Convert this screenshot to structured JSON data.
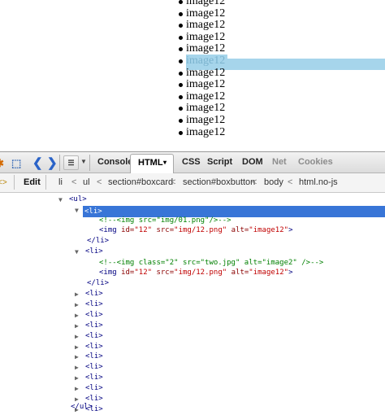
{
  "page": {
    "list_items": [
      "image12",
      "image12",
      "image12",
      "image12",
      "image12",
      "image12",
      "image12",
      "image12",
      "image12",
      "image12",
      "image12",
      "image12"
    ],
    "highlighted_index": 5,
    "highlight_color": "#a6d5eb"
  },
  "toolbar": {
    "icons": [
      "firebug-bug-icon",
      "inspect-icon",
      "back-arrow-icon",
      "forward-arrow-icon",
      "panel-list-icon",
      "dropdown-icon"
    ],
    "tabs": {
      "console": "Console",
      "html": "HTML",
      "css": "CSS",
      "script": "Script",
      "dom": "DOM",
      "net": "Net",
      "cookies": "Cookies"
    },
    "active_tab": "HTML",
    "html_dropdown": "▾",
    "disabled_tab": "Net"
  },
  "breadcrumbs": {
    "edit_label": "Edit",
    "items": [
      "li",
      "ul",
      "section#boxcard",
      "section#boxbutton",
      "body",
      "html.no-js"
    ],
    "separator": "<"
  },
  "tree": {
    "ul_open": "<ul>",
    "li_open": "<li>",
    "li_close": "</li>",
    "ul_close": "</ul>",
    "comment1": "<!--<img src=\"img/01.png\"/>-->",
    "img1": {
      "tag_open": "<img ",
      "attrs": [
        {
          "name": "id=",
          "value": "\"12\""
        },
        {
          "name": "src=",
          "value": "\"img/12.png\""
        },
        {
          "name": "alt=",
          "value": "\"image12\""
        }
      ],
      "tag_close": ">"
    },
    "comment2": "<!--<img class=\"2\" src=\"two.jpg\" alt=\"image2\" />-->",
    "collapsed_li_count": 12,
    "selection_color": "#3875d7"
  }
}
